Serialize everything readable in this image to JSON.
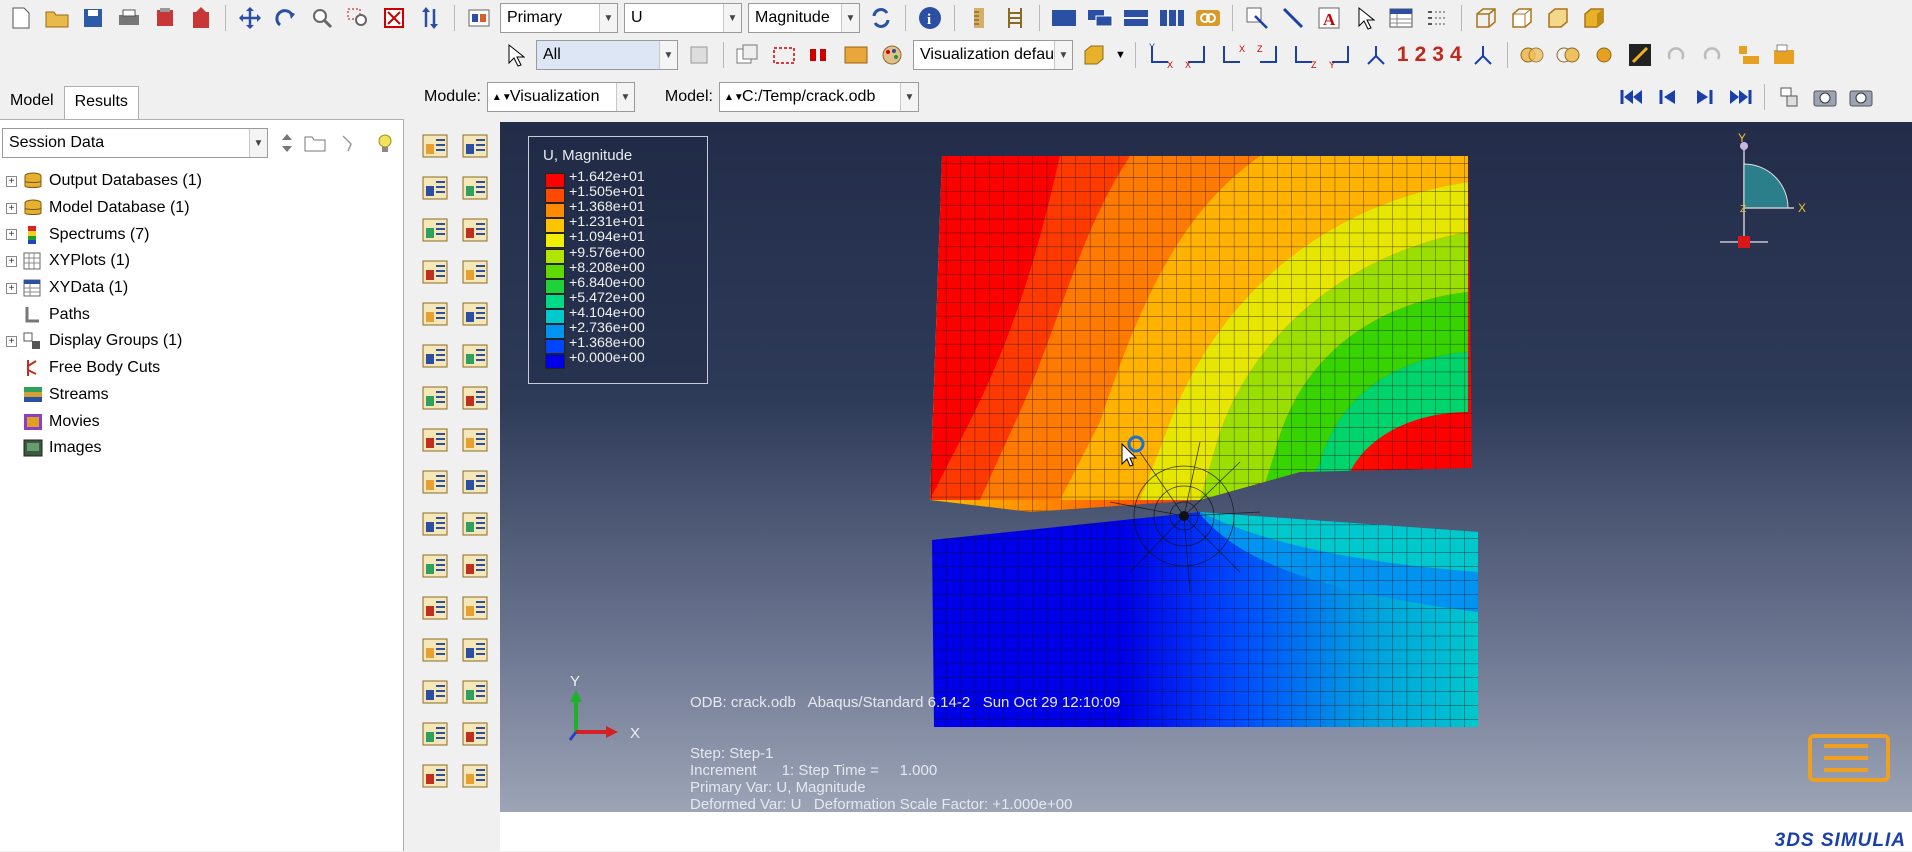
{
  "toolbar": {
    "primary_select": "Primary",
    "variable_select": "U",
    "invariant_select": "Magnitude",
    "filter_select": "All",
    "viz_defaults_select": "Visualization defaults",
    "view_numbers": [
      "1",
      "2",
      "3",
      "4"
    ]
  },
  "context": {
    "module_label": "Module:",
    "module_value": "Visualization",
    "model_label": "Model:",
    "model_value": "C:/Temp/crack.odb"
  },
  "left": {
    "tabs": [
      "Model",
      "Results"
    ],
    "session_select": "Session Data",
    "tree": [
      {
        "label": "Output Databases (1)",
        "expand": true,
        "icon": "database-icon"
      },
      {
        "label": "Model Database (1)",
        "expand": true,
        "icon": "database-icon"
      },
      {
        "label": "Spectrums (7)",
        "expand": true,
        "icon": "spectrum-icon"
      },
      {
        "label": "XYPlots (1)",
        "expand": true,
        "icon": "xyplot-icon"
      },
      {
        "label": "XYData (1)",
        "expand": true,
        "icon": "xydata-icon"
      },
      {
        "label": "Paths",
        "expand": false,
        "icon": "path-icon"
      },
      {
        "label": "Display Groups (1)",
        "expand": true,
        "icon": "display-group-icon"
      },
      {
        "label": "Free Body Cuts",
        "expand": false,
        "icon": "free-body-icon"
      },
      {
        "label": "Streams",
        "expand": false,
        "icon": "stream-icon"
      },
      {
        "label": "Movies",
        "expand": false,
        "icon": "movie-icon"
      },
      {
        "label": "Images",
        "expand": false,
        "icon": "image-icon"
      }
    ]
  },
  "legend": {
    "title": "U, Magnitude",
    "values": [
      "+1.642e+01",
      "+1.505e+01",
      "+1.368e+01",
      "+1.231e+01",
      "+1.094e+01",
      "+9.576e+00",
      "+8.208e+00",
      "+6.840e+00",
      "+5.472e+00",
      "+4.104e+00",
      "+2.736e+00",
      "+1.368e+00",
      "+0.000e+00"
    ],
    "colors": [
      "#ff0000",
      "#ff4a00",
      "#ff8a00",
      "#ffc400",
      "#f0ef00",
      "#b0e500",
      "#5fd800",
      "#1fd23a",
      "#00d88a",
      "#00cad0",
      "#0093f0",
      "#0046ff",
      "#0000e8"
    ]
  },
  "triad": {
    "y": "Y",
    "x": "X",
    "z": "Z"
  },
  "info": {
    "odb": "ODB: crack.odb",
    "solver": "Abaqus/Standard 6.14-2",
    "date": "Sun Oct 29 12:10:09",
    "step": "Step: Step-1",
    "increment": "Increment      1: Step Time =     1.000",
    "primary_var": "Primary Var: U, Magnitude",
    "deformed_var": "Deformed Var: U   Deformation Scale Factor: +1.000e+00"
  },
  "viewport_triad": {
    "y": "Y",
    "x": "X"
  },
  "brand": "3DS SIMULIA"
}
